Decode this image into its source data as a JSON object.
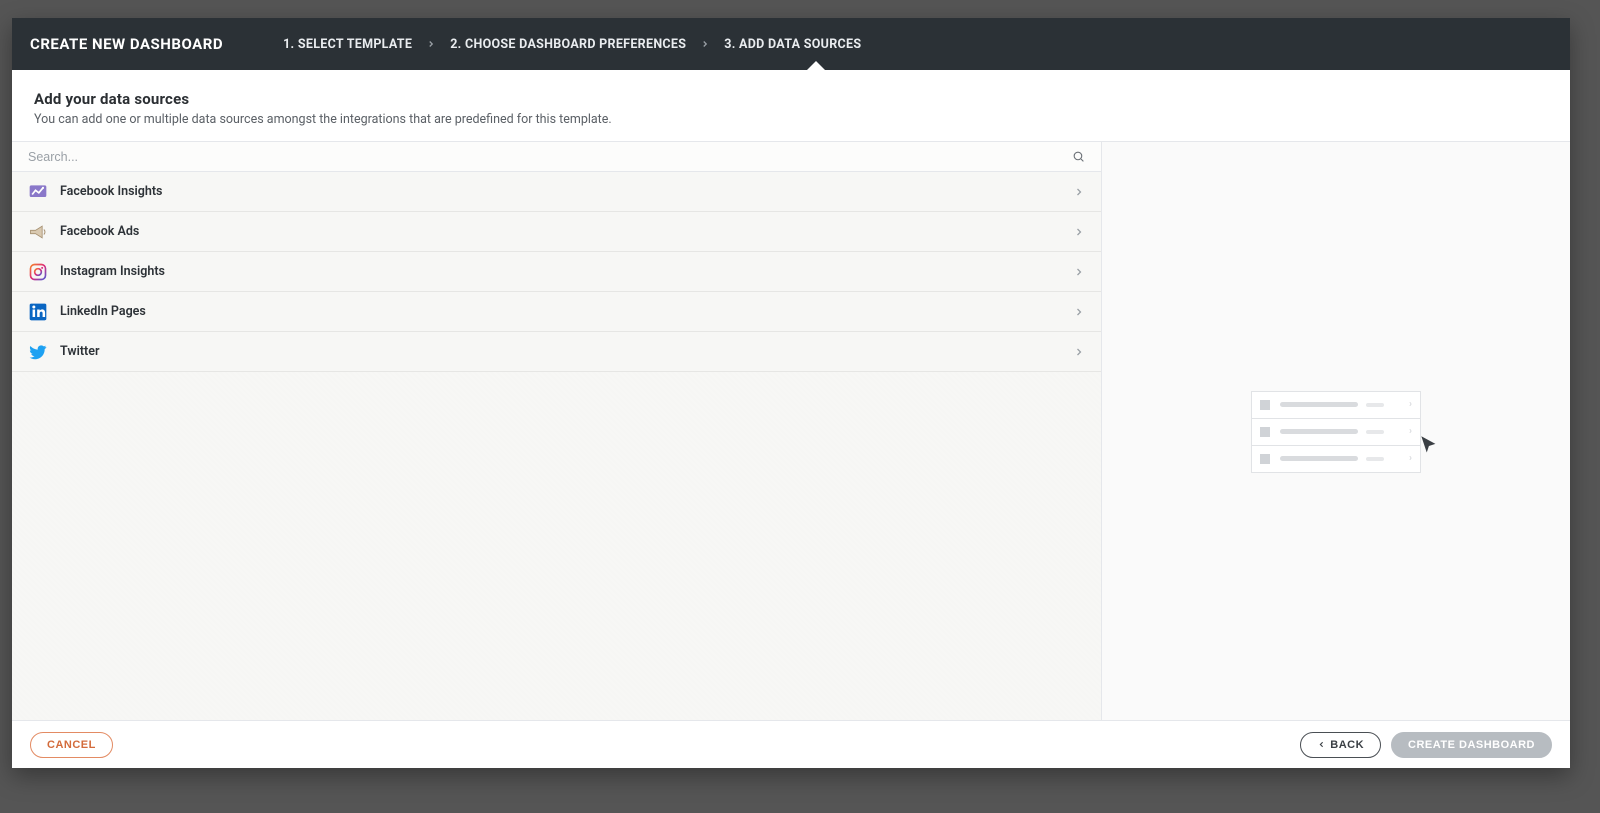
{
  "header": {
    "title": "CREATE NEW DASHBOARD",
    "steps": [
      "1. SELECT TEMPLATE",
      "2. CHOOSE DASHBOARD PREFERENCES",
      "3. ADD DATA SOURCES"
    ]
  },
  "intro": {
    "heading": "Add your data sources",
    "subtext": "You can add one or multiple data sources amongst the integrations that are predefined for this template."
  },
  "search": {
    "placeholder": "Search..."
  },
  "sources": [
    {
      "label": "Facebook Insights",
      "icon": "facebook-insights"
    },
    {
      "label": "Facebook Ads",
      "icon": "facebook-ads"
    },
    {
      "label": "Instagram Insights",
      "icon": "instagram"
    },
    {
      "label": "LinkedIn Pages",
      "icon": "linkedin"
    },
    {
      "label": "Twitter",
      "icon": "twitter"
    }
  ],
  "footer": {
    "cancel": "CANCEL",
    "back": "BACK",
    "create": "CREATE DASHBOARD"
  }
}
